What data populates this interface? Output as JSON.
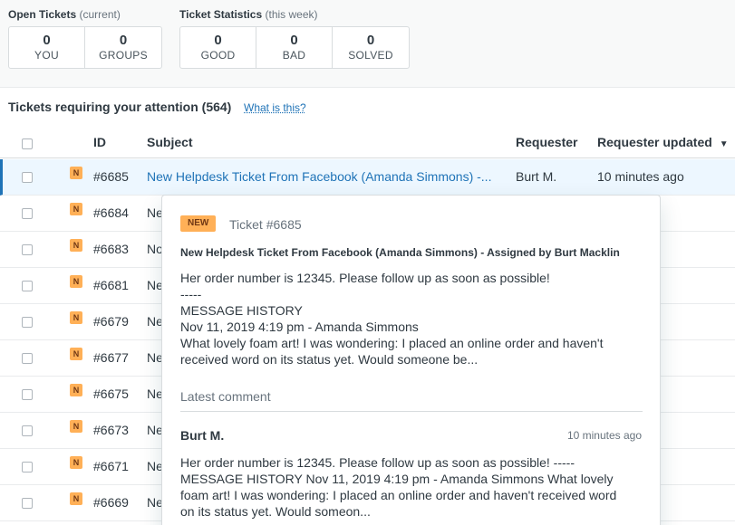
{
  "stats": {
    "open": {
      "title": "Open Tickets",
      "subtitle": "(current)",
      "boxes": [
        {
          "value": "0",
          "label": "YOU"
        },
        {
          "value": "0",
          "label": "GROUPS"
        }
      ]
    },
    "weekly": {
      "title": "Ticket Statistics",
      "subtitle": "(this week)",
      "boxes": [
        {
          "value": "0",
          "label": "GOOD"
        },
        {
          "value": "0",
          "label": "BAD"
        },
        {
          "value": "0",
          "label": "SOLVED"
        }
      ]
    }
  },
  "section": {
    "title": "Tickets requiring your attention (564)",
    "help_link": "What is this?"
  },
  "table": {
    "columns": {
      "id": "ID",
      "subject": "Subject",
      "requester": "Requester",
      "updated": "Requester updated",
      "sort_icon": "▼"
    },
    "rows": [
      {
        "status": "N",
        "id": "#6685",
        "subject": "New Helpdesk Ticket From Facebook (Amanda Simmons) -...",
        "requester": "Burt M.",
        "updated": "10 minutes ago"
      },
      {
        "status": "N",
        "id": "#6684",
        "subject": "Ne",
        "requester": "",
        "updated": ""
      },
      {
        "status": "N",
        "id": "#6683",
        "subject": "No",
        "requester": "",
        "updated": ""
      },
      {
        "status": "N",
        "id": "#6681",
        "subject": "Ne",
        "requester": "",
        "updated": ""
      },
      {
        "status": "N",
        "id": "#6679",
        "subject": "Ne",
        "requester": "",
        "updated": ""
      },
      {
        "status": "N",
        "id": "#6677",
        "subject": "Ne",
        "requester": "",
        "updated": ""
      },
      {
        "status": "N",
        "id": "#6675",
        "subject": "Ne",
        "requester": "",
        "updated": ""
      },
      {
        "status": "N",
        "id": "#6673",
        "subject": "Ne",
        "requester": "",
        "updated": ""
      },
      {
        "status": "N",
        "id": "#6671",
        "subject": "Ne",
        "requester": "",
        "updated": ""
      },
      {
        "status": "N",
        "id": "#6669",
        "subject": "Ne",
        "requester": "",
        "updated": ""
      }
    ]
  },
  "popover": {
    "status": "NEW",
    "ticket_number": "Ticket #6685",
    "title": "New Helpdesk Ticket From Facebook (Amanda Simmons) - Assigned by Burt Macklin",
    "description_lines": [
      "Her order number is 12345. Please follow up as soon as possible!",
      "-----",
      "MESSAGE HISTORY",
      "Nov 11, 2019 4:19 pm - Amanda Simmons",
      "What lovely foam art! I was wondering: I placed an online order and haven't",
      "received word on its status yet. Would someone be..."
    ],
    "latest_label": "Latest comment",
    "comment_author": "Burt M.",
    "comment_time": "10 minutes ago",
    "comment_lines": [
      "Her order number is 12345. Please follow up as soon as possible! -----",
      "MESSAGE HISTORY Nov 11, 2019 4:19 pm - Amanda Simmons What lovely",
      "foam art! I was wondering: I placed an online order and haven't received word",
      "on its status yet. Would someon..."
    ]
  },
  "colors": {
    "accent": "#1f73b7",
    "new_badge": "#ffb057",
    "row_highlight": "#edf7ff"
  }
}
